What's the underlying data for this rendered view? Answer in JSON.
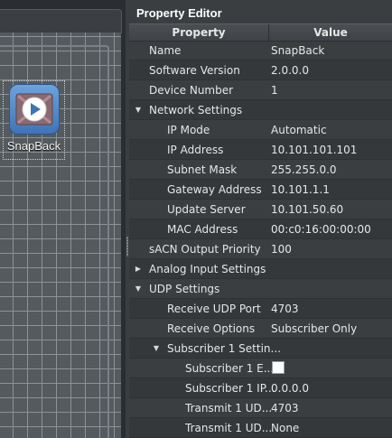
{
  "canvas": {
    "device_label": "SnapBack"
  },
  "panel": {
    "title": "Property Editor",
    "headers": {
      "property": "Property",
      "value": "Value"
    }
  },
  "rows": [
    {
      "label": "Name",
      "value": "SnapBack"
    },
    {
      "label": "Software Version",
      "value": "2.0.0.0"
    },
    {
      "label": "Device Number",
      "value": "1"
    },
    {
      "label": "Network Settings",
      "value": ""
    },
    {
      "label": "IP Mode",
      "value": "Automatic"
    },
    {
      "label": "IP Address",
      "value": "10.101.101.101"
    },
    {
      "label": "Subnet Mask",
      "value": "255.255.0.0"
    },
    {
      "label": "Gateway Address",
      "value": "10.101.1.1"
    },
    {
      "label": "Update Server",
      "value": "10.101.50.60"
    },
    {
      "label": "MAC Address",
      "value": "00:c0:16:00:00:00"
    },
    {
      "label": "sACN Output Priority",
      "value": "100"
    },
    {
      "label": "Analog Input Settings",
      "value": ""
    },
    {
      "label": "UDP Settings",
      "value": ""
    },
    {
      "label": "Receive UDP Port",
      "value": "4703"
    },
    {
      "label": "Receive Options",
      "value": "Subscriber Only"
    },
    {
      "label": "Subscriber 1 Settin...",
      "value": ""
    },
    {
      "label": "Subscriber 1 E...",
      "value": "",
      "checked": false
    },
    {
      "label": "Subscriber 1 IP...",
      "value": "0.0.0.0"
    },
    {
      "label": "Transmit 1 UD...",
      "value": "4703"
    },
    {
      "label": "Transmit 1 UD...",
      "value": "None"
    }
  ],
  "icons": {
    "device": "play-film-icon",
    "expanded": "triangle-down-icon",
    "collapsed": "triangle-right-icon"
  }
}
